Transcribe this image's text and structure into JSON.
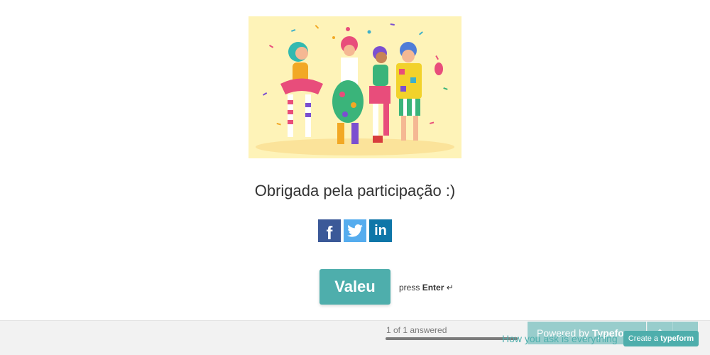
{
  "hero": {
    "alt": "carnival illustration"
  },
  "message": "Obrigada pela participação :)",
  "share": {
    "facebook_glyph": "f",
    "linkedin_glyph": "in"
  },
  "cta": {
    "label": "Valeu"
  },
  "hint": {
    "press": "press",
    "key": "Enter",
    "return_glyph": "↵"
  },
  "footer": {
    "progress_text": "1 of 1 answered",
    "progress_fraction": 1.0,
    "powered_prefix": "Powered by",
    "powered_brand": "Typeform",
    "up_glyph": "⌃",
    "down_glyph": "⌄",
    "tagline": "How you ask is everything",
    "create_prefix": "Create a",
    "create_brand": "typeform"
  },
  "colors": {
    "accent": "#4eaeac",
    "hero_bg": "#fef3b8",
    "facebook": "#3b5998",
    "twitter": "#55acee",
    "linkedin": "#0e76a8"
  }
}
